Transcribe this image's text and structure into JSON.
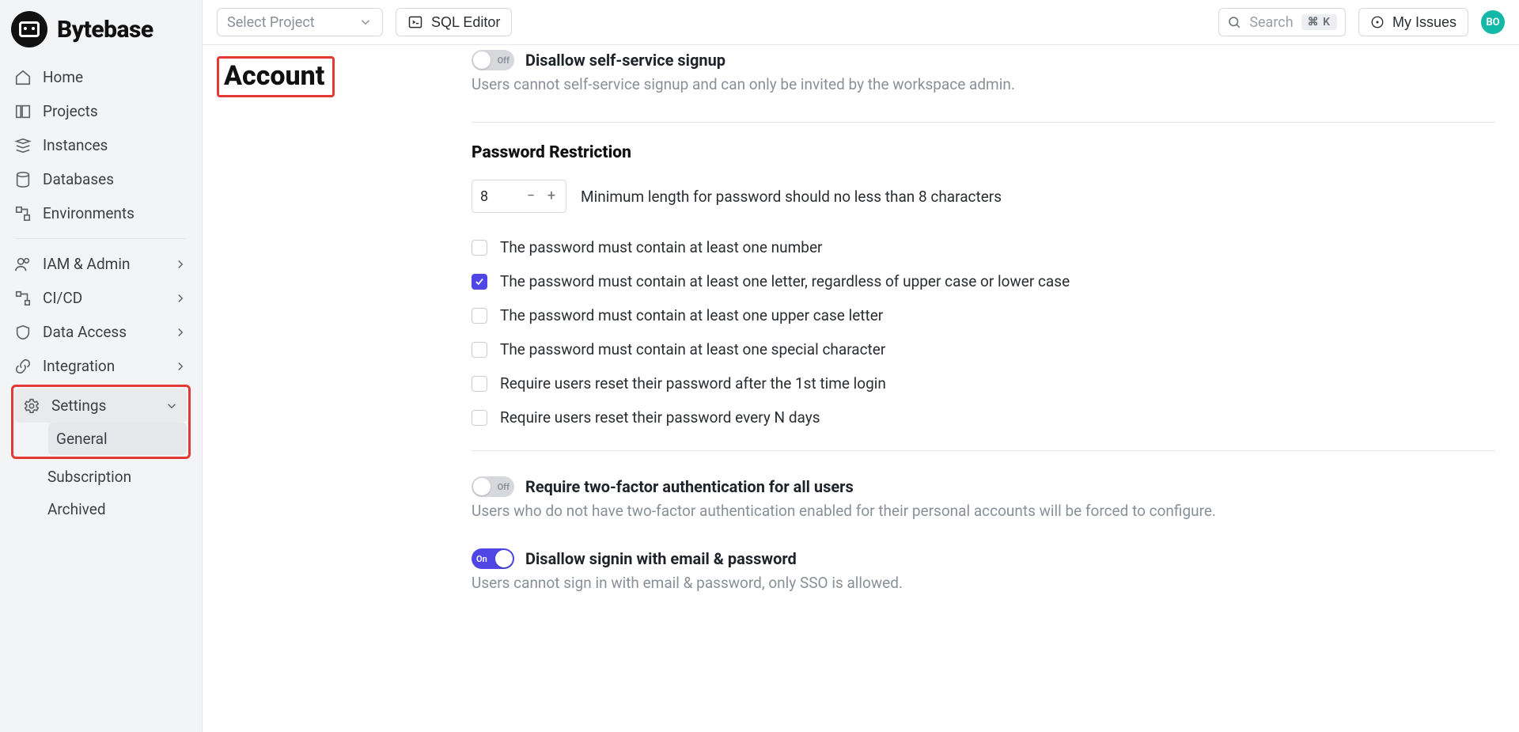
{
  "brand": "Bytebase",
  "sidebar": {
    "primary": [
      {
        "label": "Home"
      },
      {
        "label": "Projects"
      },
      {
        "label": "Instances"
      },
      {
        "label": "Databases"
      },
      {
        "label": "Environments"
      }
    ],
    "secondary": [
      {
        "label": "IAM & Admin"
      },
      {
        "label": "CI/CD"
      },
      {
        "label": "Data Access"
      },
      {
        "label": "Integration"
      }
    ],
    "settings": {
      "label": "Settings",
      "children": [
        {
          "label": "General"
        },
        {
          "label": "Subscription"
        },
        {
          "label": "Archived"
        }
      ]
    }
  },
  "topbar": {
    "select_project": "Select Project",
    "sql_editor": "SQL Editor",
    "search_placeholder": "Search",
    "search_kbd": "⌘ K",
    "my_issues": "My Issues",
    "avatar": "BO"
  },
  "page": {
    "title": "Account",
    "signup": {
      "toggle_state": "off",
      "toggle_label": "Off",
      "title": "Disallow self-service signup",
      "desc": "Users cannot self-service signup and can only be invited by the workspace admin."
    },
    "password_section_title": "Password Restriction",
    "min_length": {
      "value": "8",
      "desc": "Minimum length for password should no less than 8 characters"
    },
    "checks": [
      {
        "checked": false,
        "label": "The password must contain at least one number"
      },
      {
        "checked": true,
        "label": "The password must contain at least one letter, regardless of upper case or lower case"
      },
      {
        "checked": false,
        "label": "The password must contain at least one upper case letter"
      },
      {
        "checked": false,
        "label": "The password must contain at least one special character"
      },
      {
        "checked": false,
        "label": "Require users reset their password after the 1st time login"
      },
      {
        "checked": false,
        "label": "Require users reset their password every N days"
      }
    ],
    "twofa": {
      "toggle_state": "off",
      "toggle_label": "Off",
      "title": "Require two-factor authentication for all users",
      "desc": "Users who do not have two-factor authentication enabled for their personal accounts will be forced to configure."
    },
    "disallow_signin": {
      "toggle_state": "on",
      "toggle_label": "On",
      "title": "Disallow signin with email & password",
      "desc": "Users cannot sign in with email & password, only SSO is allowed."
    }
  }
}
